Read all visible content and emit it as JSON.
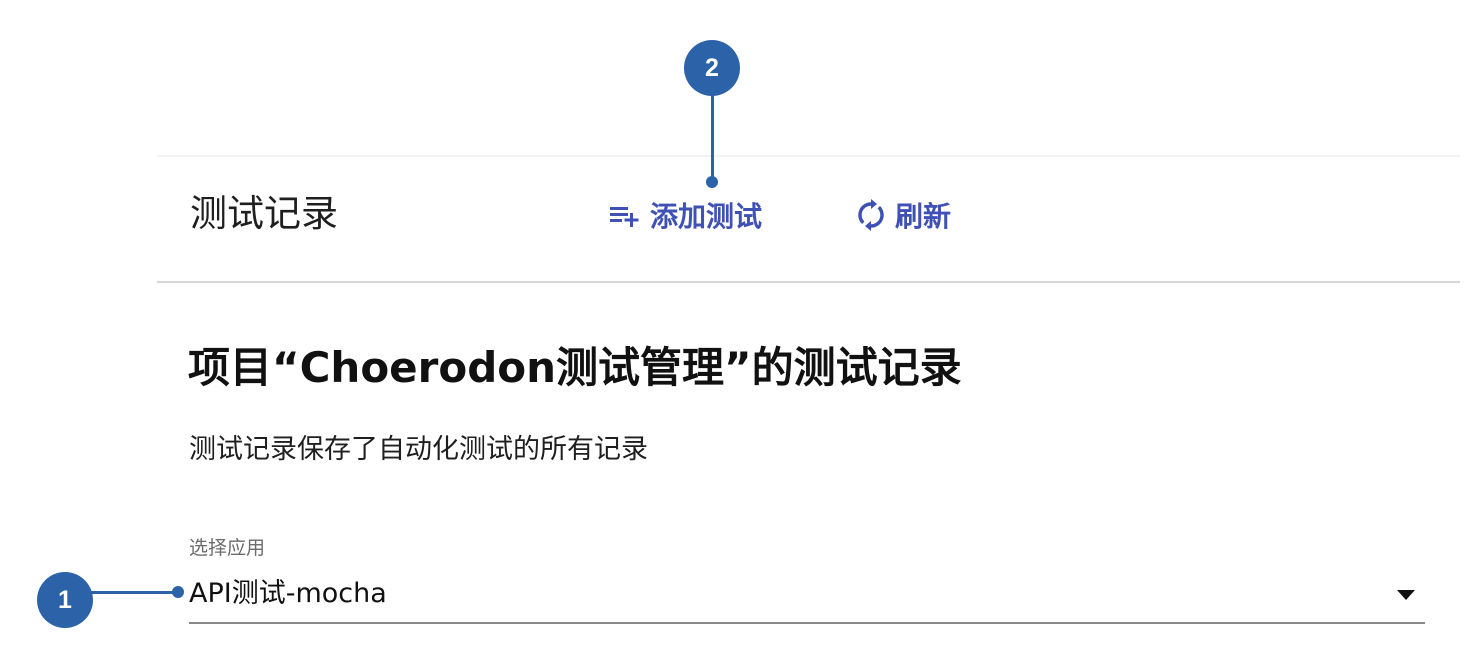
{
  "header": {
    "title": "测试记录",
    "add_test_label": "添加测试",
    "refresh_label": "刷新"
  },
  "main": {
    "section_title": "项目“Choerodon测试管理”的测试记录",
    "section_desc": "测试记录保存了自动化测试的所有记录",
    "select_label": "选择应用",
    "select_value": "API测试-mocha"
  },
  "callouts": {
    "badge_1": "1",
    "badge_2": "2"
  },
  "colors": {
    "accent": "#3f51b5",
    "callout": "#2c63a8"
  },
  "icons": {
    "add_test": "playlist-add-icon",
    "refresh": "refresh-icon",
    "dropdown": "caret-down-icon"
  }
}
